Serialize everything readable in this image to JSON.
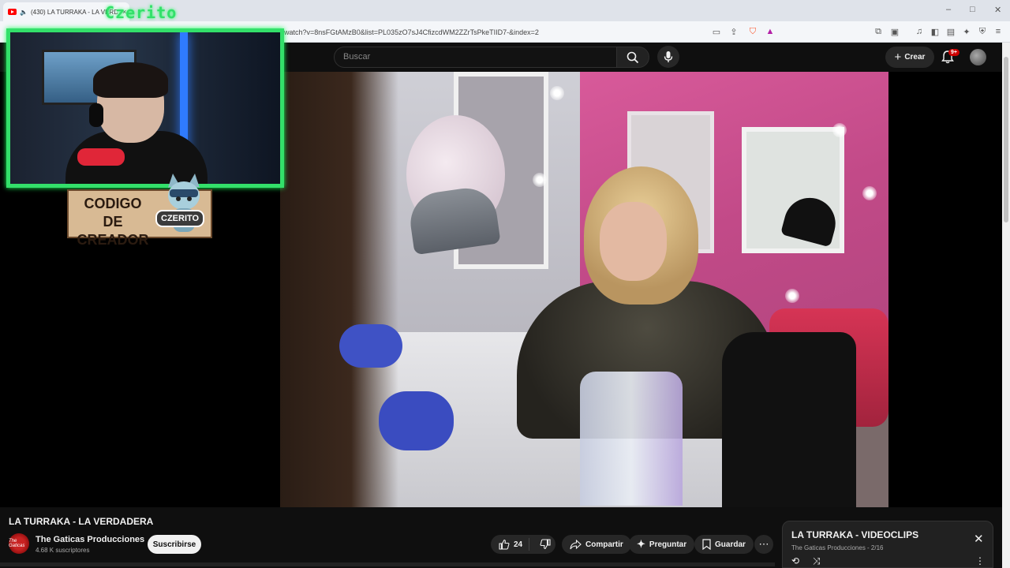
{
  "browser": {
    "tab_title": "(430) LA TURRAKA - LA VERDADERA",
    "tab_close": "×",
    "url": "watch?v=8nsFGtAMzB0&list=PL035zO7sJ4CfizcdWM2ZZrTsPkeTIID7-&index=2",
    "window_minimize": "–",
    "window_restore": "□",
    "window_close": "✕"
  },
  "youtube": {
    "search_placeholder": "Buscar",
    "create_label": "Crear",
    "notifications_badge": "9+"
  },
  "overlay": {
    "streamer_name": "Czerito",
    "code_line1": "CODIGO",
    "code_line2": "DE CREADOR",
    "code_tag": "CZERITO"
  },
  "video": {
    "title": "LA TURRAKA - LA VERDADERA",
    "channel_name": "The Gaticas Producciones",
    "channel_avatar_text": "The Gaticas",
    "subscribers": "4.68 K suscriptores",
    "subscribe_label": "Suscribirse",
    "likes": "24",
    "share_label": "Compartir",
    "ask_label": "Preguntar",
    "save_label": "Guardar"
  },
  "playlist": {
    "title": "LA TURRAKA - VIDEOCLIPS",
    "subtitle": "The Gaticas Producciones - 2/16"
  },
  "colors": {
    "overlay_green": "#33e06a",
    "youtube_red": "#ff0000",
    "background": "#0f0f0f"
  }
}
